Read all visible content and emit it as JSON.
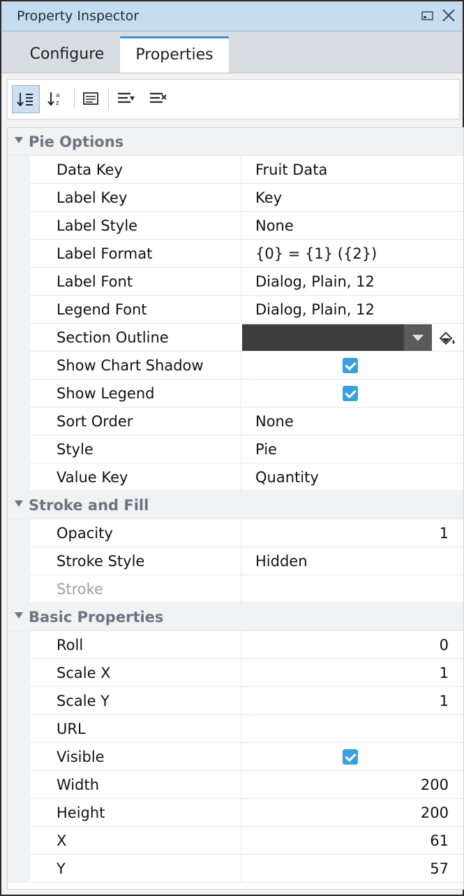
{
  "window": {
    "title": "Property Inspector"
  },
  "tabs": [
    {
      "label": "Configure",
      "selected": false
    },
    {
      "label": "Properties",
      "selected": true
    }
  ],
  "toolbar": {
    "icons": [
      "sort-categorized-icon",
      "sort-alphabetical-icon",
      "details-icon",
      "expand-all-icon",
      "collapse-all-icon"
    ]
  },
  "groups": {
    "pie_options": {
      "label": "Pie Options",
      "props": [
        {
          "name": "Data Key",
          "value": "Fruit Data"
        },
        {
          "name": "Label Key",
          "value": "Key"
        },
        {
          "name": "Label Style",
          "value": "None"
        },
        {
          "name": "Label Format",
          "value": "{0} = {1} ({2})"
        },
        {
          "name": "Label Font",
          "value": "Dialog, Plain, 12"
        },
        {
          "name": "Legend Font",
          "value": "Dialog, Plain, 12"
        },
        {
          "name": "Section Outline",
          "color": "#3d3d3d"
        },
        {
          "name": "Show Chart Shadow",
          "checked": true
        },
        {
          "name": "Show Legend",
          "checked": true
        },
        {
          "name": "Sort Order",
          "value": "None"
        },
        {
          "name": "Style",
          "value": "Pie"
        },
        {
          "name": "Value Key",
          "value": "Quantity"
        }
      ]
    },
    "stroke_fill": {
      "label": "Stroke and Fill",
      "props": [
        {
          "name": "Opacity",
          "value": "1"
        },
        {
          "name": "Stroke Style",
          "value": "Hidden"
        },
        {
          "name": "Stroke",
          "value": ""
        }
      ]
    },
    "basic": {
      "label": "Basic Properties",
      "props": [
        {
          "name": "Roll",
          "value": "0"
        },
        {
          "name": "Scale X",
          "value": "1"
        },
        {
          "name": "Scale Y",
          "value": "1"
        },
        {
          "name": "URL",
          "value": ""
        },
        {
          "name": "Visible",
          "checked": true
        },
        {
          "name": "Width",
          "value": "200"
        },
        {
          "name": "Height",
          "value": "200"
        },
        {
          "name": "X",
          "value": "61"
        },
        {
          "name": "Y",
          "value": "57"
        }
      ]
    }
  },
  "colors": {
    "accent": "#3c9fdd",
    "title_bar": "#c6dcef",
    "section_outline": "#3d3d3d"
  }
}
